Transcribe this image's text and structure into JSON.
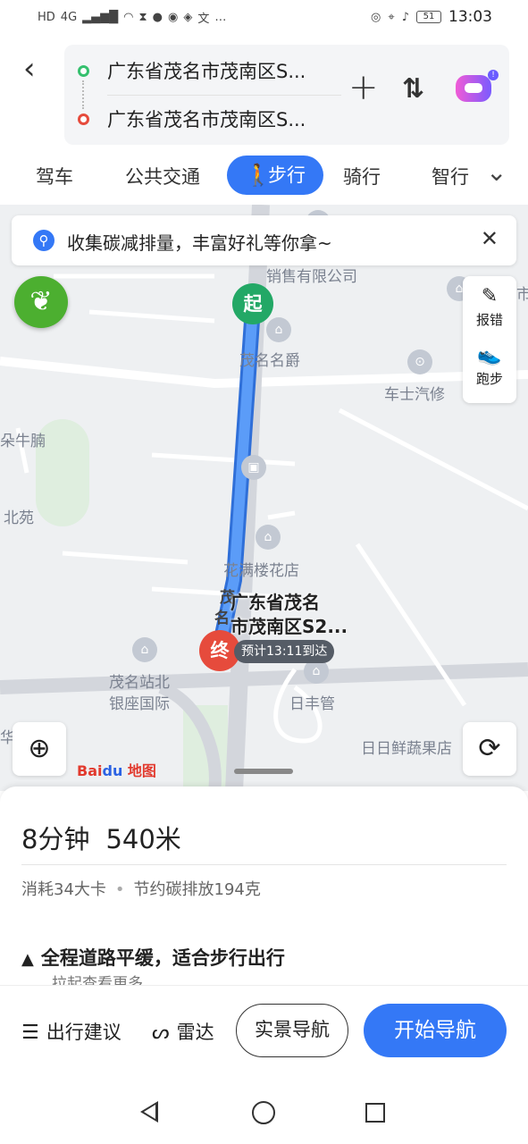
{
  "status_bar": {
    "left_icons": [
      "HD",
      "4G",
      "signal-icon",
      "wifi-icon",
      "hourglass-icon",
      "qq-icon",
      "app-icon",
      "bulb-icon",
      "文",
      "…"
    ],
    "network": "4G",
    "hd": "HD",
    "text_icon": "文",
    "overflow": "…",
    "battery": "51",
    "time": "13:03"
  },
  "route": {
    "start": "广东省茂名市茂南区S...",
    "end": "广东省茂名市茂南区S..."
  },
  "modes": [
    {
      "label": "驾车",
      "active": false
    },
    {
      "label": "公共交通",
      "active": false
    },
    {
      "label": "步行",
      "active": true
    },
    {
      "label": "骑行",
      "active": false
    },
    {
      "label": "智行",
      "active": false
    }
  ],
  "map": {
    "banner_text": "收集碳减排量，丰富好礼等你拿~",
    "report_label": "报错",
    "run_label": "跑步",
    "start_pin": "起",
    "end_pin": "终",
    "dest_label_line1": "广东省茂名",
    "dest_label_line2": "市茂南区S2...",
    "eta": "预计13:11到达",
    "labels": {
      "sales": "销售有限公司",
      "maoming_mingjue": "茂名名爵",
      "chesi": "车士汽修",
      "niunan": "朵牛腩",
      "beiyuan": "北苑",
      "huaman": "花满楼花店",
      "station_north": "茂名站北",
      "yinzuo": "银座国际",
      "rifeng": "日丰管",
      "riri": "日日鲜蔬果店",
      "road_mao": "茂",
      "road_ming": "名",
      "edge_shi": "市",
      "edge_hua": "华"
    },
    "logo_text": "Bai",
    "logo_suffix": "地图",
    "colors": {
      "route": "#3d86f5",
      "start": "#23a866",
      "end": "#e64b3c"
    }
  },
  "summary": {
    "duration": "8分钟",
    "distance": "540米",
    "calories": "消耗34大卡",
    "carbon": "节约碳排放194克",
    "tip": "全程道路平缓，适合步行出行",
    "tip_sub": "拉起查看更多"
  },
  "actions": {
    "suggest": "出行建议",
    "radar": "雷达",
    "ar_nav": "实景导航",
    "start_nav": "开始导航"
  },
  "colors": {
    "primary": "#3478f6"
  }
}
